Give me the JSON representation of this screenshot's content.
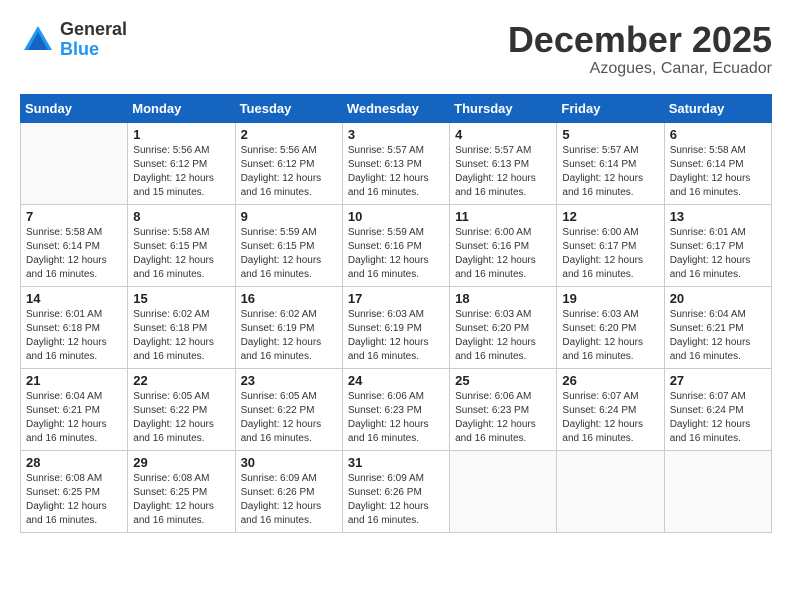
{
  "header": {
    "logo_general": "General",
    "logo_blue": "Blue",
    "month_year": "December 2025",
    "location": "Azogues, Canar, Ecuador"
  },
  "calendar": {
    "days_of_week": [
      "Sunday",
      "Monday",
      "Tuesday",
      "Wednesday",
      "Thursday",
      "Friday",
      "Saturday"
    ],
    "weeks": [
      [
        {
          "day": "",
          "sunrise": "",
          "sunset": "",
          "daylight": ""
        },
        {
          "day": "1",
          "sunrise": "Sunrise: 5:56 AM",
          "sunset": "Sunset: 6:12 PM",
          "daylight": "Daylight: 12 hours and 15 minutes."
        },
        {
          "day": "2",
          "sunrise": "Sunrise: 5:56 AM",
          "sunset": "Sunset: 6:12 PM",
          "daylight": "Daylight: 12 hours and 16 minutes."
        },
        {
          "day": "3",
          "sunrise": "Sunrise: 5:57 AM",
          "sunset": "Sunset: 6:13 PM",
          "daylight": "Daylight: 12 hours and 16 minutes."
        },
        {
          "day": "4",
          "sunrise": "Sunrise: 5:57 AM",
          "sunset": "Sunset: 6:13 PM",
          "daylight": "Daylight: 12 hours and 16 minutes."
        },
        {
          "day": "5",
          "sunrise": "Sunrise: 5:57 AM",
          "sunset": "Sunset: 6:14 PM",
          "daylight": "Daylight: 12 hours and 16 minutes."
        },
        {
          "day": "6",
          "sunrise": "Sunrise: 5:58 AM",
          "sunset": "Sunset: 6:14 PM",
          "daylight": "Daylight: 12 hours and 16 minutes."
        }
      ],
      [
        {
          "day": "7",
          "sunrise": "Sunrise: 5:58 AM",
          "sunset": "Sunset: 6:14 PM",
          "daylight": "Daylight: 12 hours and 16 minutes."
        },
        {
          "day": "8",
          "sunrise": "Sunrise: 5:58 AM",
          "sunset": "Sunset: 6:15 PM",
          "daylight": "Daylight: 12 hours and 16 minutes."
        },
        {
          "day": "9",
          "sunrise": "Sunrise: 5:59 AM",
          "sunset": "Sunset: 6:15 PM",
          "daylight": "Daylight: 12 hours and 16 minutes."
        },
        {
          "day": "10",
          "sunrise": "Sunrise: 5:59 AM",
          "sunset": "Sunset: 6:16 PM",
          "daylight": "Daylight: 12 hours and 16 minutes."
        },
        {
          "day": "11",
          "sunrise": "Sunrise: 6:00 AM",
          "sunset": "Sunset: 6:16 PM",
          "daylight": "Daylight: 12 hours and 16 minutes."
        },
        {
          "day": "12",
          "sunrise": "Sunrise: 6:00 AM",
          "sunset": "Sunset: 6:17 PM",
          "daylight": "Daylight: 12 hours and 16 minutes."
        },
        {
          "day": "13",
          "sunrise": "Sunrise: 6:01 AM",
          "sunset": "Sunset: 6:17 PM",
          "daylight": "Daylight: 12 hours and 16 minutes."
        }
      ],
      [
        {
          "day": "14",
          "sunrise": "Sunrise: 6:01 AM",
          "sunset": "Sunset: 6:18 PM",
          "daylight": "Daylight: 12 hours and 16 minutes."
        },
        {
          "day": "15",
          "sunrise": "Sunrise: 6:02 AM",
          "sunset": "Sunset: 6:18 PM",
          "daylight": "Daylight: 12 hours and 16 minutes."
        },
        {
          "day": "16",
          "sunrise": "Sunrise: 6:02 AM",
          "sunset": "Sunset: 6:19 PM",
          "daylight": "Daylight: 12 hours and 16 minutes."
        },
        {
          "day": "17",
          "sunrise": "Sunrise: 6:03 AM",
          "sunset": "Sunset: 6:19 PM",
          "daylight": "Daylight: 12 hours and 16 minutes."
        },
        {
          "day": "18",
          "sunrise": "Sunrise: 6:03 AM",
          "sunset": "Sunset: 6:20 PM",
          "daylight": "Daylight: 12 hours and 16 minutes."
        },
        {
          "day": "19",
          "sunrise": "Sunrise: 6:03 AM",
          "sunset": "Sunset: 6:20 PM",
          "daylight": "Daylight: 12 hours and 16 minutes."
        },
        {
          "day": "20",
          "sunrise": "Sunrise: 6:04 AM",
          "sunset": "Sunset: 6:21 PM",
          "daylight": "Daylight: 12 hours and 16 minutes."
        }
      ],
      [
        {
          "day": "21",
          "sunrise": "Sunrise: 6:04 AM",
          "sunset": "Sunset: 6:21 PM",
          "daylight": "Daylight: 12 hours and 16 minutes."
        },
        {
          "day": "22",
          "sunrise": "Sunrise: 6:05 AM",
          "sunset": "Sunset: 6:22 PM",
          "daylight": "Daylight: 12 hours and 16 minutes."
        },
        {
          "day": "23",
          "sunrise": "Sunrise: 6:05 AM",
          "sunset": "Sunset: 6:22 PM",
          "daylight": "Daylight: 12 hours and 16 minutes."
        },
        {
          "day": "24",
          "sunrise": "Sunrise: 6:06 AM",
          "sunset": "Sunset: 6:23 PM",
          "daylight": "Daylight: 12 hours and 16 minutes."
        },
        {
          "day": "25",
          "sunrise": "Sunrise: 6:06 AM",
          "sunset": "Sunset: 6:23 PM",
          "daylight": "Daylight: 12 hours and 16 minutes."
        },
        {
          "day": "26",
          "sunrise": "Sunrise: 6:07 AM",
          "sunset": "Sunset: 6:24 PM",
          "daylight": "Daylight: 12 hours and 16 minutes."
        },
        {
          "day": "27",
          "sunrise": "Sunrise: 6:07 AM",
          "sunset": "Sunset: 6:24 PM",
          "daylight": "Daylight: 12 hours and 16 minutes."
        }
      ],
      [
        {
          "day": "28",
          "sunrise": "Sunrise: 6:08 AM",
          "sunset": "Sunset: 6:25 PM",
          "daylight": "Daylight: 12 hours and 16 minutes."
        },
        {
          "day": "29",
          "sunrise": "Sunrise: 6:08 AM",
          "sunset": "Sunset: 6:25 PM",
          "daylight": "Daylight: 12 hours and 16 minutes."
        },
        {
          "day": "30",
          "sunrise": "Sunrise: 6:09 AM",
          "sunset": "Sunset: 6:26 PM",
          "daylight": "Daylight: 12 hours and 16 minutes."
        },
        {
          "day": "31",
          "sunrise": "Sunrise: 6:09 AM",
          "sunset": "Sunset: 6:26 PM",
          "daylight": "Daylight: 12 hours and 16 minutes."
        },
        {
          "day": "",
          "sunrise": "",
          "sunset": "",
          "daylight": ""
        },
        {
          "day": "",
          "sunrise": "",
          "sunset": "",
          "daylight": ""
        },
        {
          "day": "",
          "sunrise": "",
          "sunset": "",
          "daylight": ""
        }
      ]
    ]
  }
}
